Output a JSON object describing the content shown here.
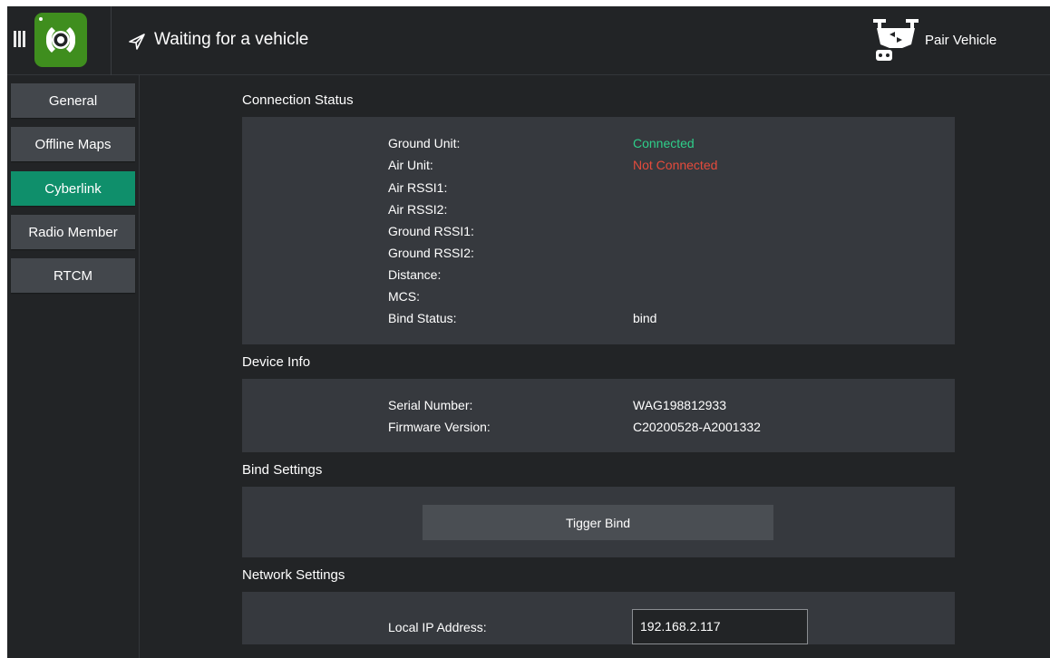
{
  "toolbar": {
    "status_text": "Waiting for a vehicle",
    "pair_label": "Pair Vehicle",
    "icons": {
      "menu": "menu-bars-icon",
      "logo": "app-logo-icon",
      "status": "paper-plane-icon",
      "pair": "drone-controller-icon"
    }
  },
  "sidebar": {
    "items": [
      {
        "label": "General",
        "active": false
      },
      {
        "label": "Offline Maps",
        "active": false
      },
      {
        "label": "Cyberlink",
        "active": true
      },
      {
        "label": "Radio Member",
        "active": false
      },
      {
        "label": "RTCM",
        "active": false
      }
    ]
  },
  "connection": {
    "title": "Connection Status",
    "rows": [
      {
        "label": "Ground Unit:",
        "value": "Connected"
      },
      {
        "label": "Air Unit:",
        "value": "Not Connected"
      },
      {
        "label": "Air RSSI1:",
        "value": ""
      },
      {
        "label": "Air RSSI2:",
        "value": ""
      },
      {
        "label": "Ground RSSI1:",
        "value": ""
      },
      {
        "label": "Ground RSSI2:",
        "value": ""
      },
      {
        "label": "Distance:",
        "value": ""
      },
      {
        "label": "MCS:",
        "value": ""
      },
      {
        "label": "Bind Status:",
        "value": "bind"
      }
    ]
  },
  "device": {
    "title": "Device Info",
    "rows": [
      {
        "label": "Serial Number:",
        "value": "WAG198812933"
      },
      {
        "label": "Firmware Version:",
        "value": "C20200528-A2001332"
      }
    ]
  },
  "bind": {
    "title": "Bind Settings",
    "button_label": "Tigger Bind"
  },
  "network": {
    "title": "Network Settings",
    "ip_label": "Local IP Address:",
    "ip_value": "192.168.2.117"
  },
  "colors": {
    "background": "#222426",
    "panel": "#36393e",
    "button": "#43474c",
    "accent_active": "#0f8f6b",
    "status_ok": "#2ecf8a",
    "status_error": "#e54b3c",
    "logo": "#3f8e1e"
  }
}
